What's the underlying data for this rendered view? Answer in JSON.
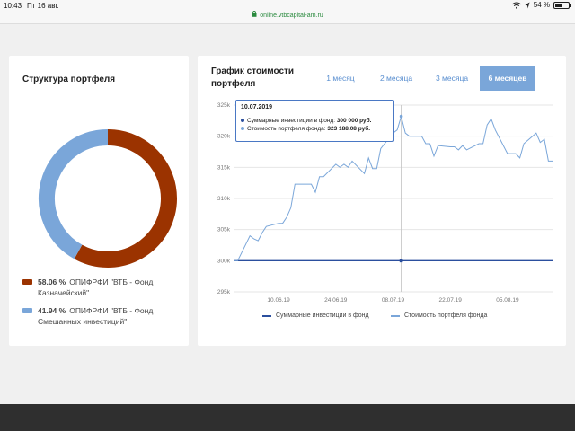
{
  "status_bar": {
    "time": "10:43",
    "date": "Пт 16 авг.",
    "battery": "54 %",
    "battery_level": 0.54
  },
  "browser": {
    "url": "online.vtbcapital-am.ru"
  },
  "portfolio_structure": {
    "title": "Структура портфеля",
    "items": [
      {
        "percent": "58.06 %",
        "name": "ОПИФРФИ \"ВТБ - Фонд Казначейский\"",
        "value": 58.06,
        "color": "#9b3300"
      },
      {
        "percent": "41.94 %",
        "name": "ОПИФРФИ \"ВТБ - Фонд Смешанных инвестиций\"",
        "value": 41.94,
        "color": "#7aa6d9"
      }
    ]
  },
  "value_chart": {
    "title": "График стоимости портфеля",
    "tabs": [
      {
        "label": "1 месяц",
        "active": false
      },
      {
        "label": "2 месяца",
        "active": false
      },
      {
        "label": "3 месяца",
        "active": false
      },
      {
        "label": "6 месяцев",
        "active": true
      }
    ],
    "tooltip": {
      "date": "10.07.2019",
      "invest_label": "Суммарные инвестиции в фонд:",
      "invest_value": "300 000 руб.",
      "value_label": "Стоимость портфеля фонда:",
      "value_value": "323 188.08 руб."
    },
    "legend": {
      "invest": "Суммарные инвестиции в фонд",
      "value": "Стоимость портфеля фонда"
    }
  },
  "chart_data": {
    "type": "line",
    "y_ticks": [
      "325k",
      "320k",
      "315k",
      "310k",
      "305k",
      "300k",
      "295k"
    ],
    "x_ticks": [
      "10.06.19",
      "24.06.19",
      "08.07.19",
      "22.07.19",
      "05.08.19"
    ],
    "ylim": [
      295000,
      325000
    ],
    "xlim": [
      "2019-05-30",
      "2019-08-16"
    ],
    "series": [
      {
        "name": "Суммарные инвестиции в фонд",
        "color": "#2b4f9e",
        "points": [
          [
            "2019-05-30",
            300000
          ],
          [
            "2019-08-16",
            300000
          ]
        ]
      },
      {
        "name": "Стоимость портфеля фонда",
        "color": "#7aa6d9",
        "points": [
          [
            "2019-05-30",
            300000
          ],
          [
            "2019-05-31",
            300000
          ],
          [
            "2019-06-03",
            304000
          ],
          [
            "2019-06-04",
            303500
          ],
          [
            "2019-06-05",
            303200
          ],
          [
            "2019-06-06",
            304500
          ],
          [
            "2019-06-07",
            305500
          ],
          [
            "2019-06-10",
            306000
          ],
          [
            "2019-06-11",
            306000
          ],
          [
            "2019-06-12",
            307000
          ],
          [
            "2019-06-13",
            308500
          ],
          [
            "2019-06-14",
            312300
          ],
          [
            "2019-06-17",
            312300
          ],
          [
            "2019-06-18",
            312300
          ],
          [
            "2019-06-19",
            311000
          ],
          [
            "2019-06-20",
            313500
          ],
          [
            "2019-06-21",
            313500
          ],
          [
            "2019-06-24",
            315500
          ],
          [
            "2019-06-25",
            315000
          ],
          [
            "2019-06-26",
            315500
          ],
          [
            "2019-06-27",
            315000
          ],
          [
            "2019-06-28",
            316000
          ],
          [
            "2019-07-01",
            314000
          ],
          [
            "2019-07-02",
            316500
          ],
          [
            "2019-07-03",
            314800
          ],
          [
            "2019-07-04",
            314800
          ],
          [
            "2019-07-05",
            318000
          ],
          [
            "2019-07-08",
            320500
          ],
          [
            "2019-07-09",
            321000
          ],
          [
            "2019-07-10",
            323188
          ],
          [
            "2019-07-11",
            320500
          ],
          [
            "2019-07-12",
            320000
          ],
          [
            "2019-07-15",
            320000
          ],
          [
            "2019-07-16",
            318800
          ],
          [
            "2019-07-17",
            318800
          ],
          [
            "2019-07-18",
            316800
          ],
          [
            "2019-07-19",
            318500
          ],
          [
            "2019-07-22",
            318300
          ],
          [
            "2019-07-23",
            318300
          ],
          [
            "2019-07-24",
            317800
          ],
          [
            "2019-07-25",
            318500
          ],
          [
            "2019-07-26",
            317800
          ],
          [
            "2019-07-29",
            318800
          ],
          [
            "2019-07-30",
            318800
          ],
          [
            "2019-07-31",
            321800
          ],
          [
            "2019-08-01",
            322800
          ],
          [
            "2019-08-02",
            321000
          ],
          [
            "2019-08-05",
            317200
          ],
          [
            "2019-08-06",
            317200
          ],
          [
            "2019-08-07",
            317200
          ],
          [
            "2019-08-08",
            316500
          ],
          [
            "2019-08-09",
            318800
          ],
          [
            "2019-08-12",
            320500
          ],
          [
            "2019-08-13",
            319000
          ],
          [
            "2019-08-14",
            319500
          ],
          [
            "2019-08-15",
            316000
          ],
          [
            "2019-08-16",
            316000
          ]
        ]
      }
    ],
    "highlight_date": "2019-07-10",
    "grid": true,
    "legend_position": "bottom"
  }
}
